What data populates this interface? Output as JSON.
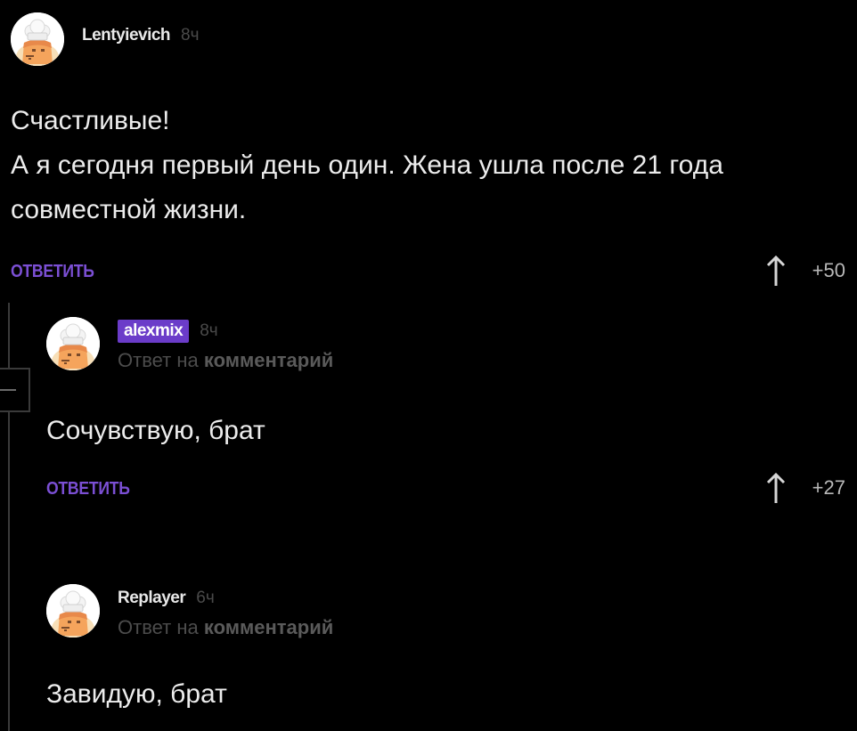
{
  "comments": [
    {
      "username": "Lentyievich",
      "time": "8ч",
      "lines": [
        "Счастливые!",
        "А я сегодня первый день один. Жена ушла после 21 года",
        "совместной жизни."
      ],
      "reply_label": "ОТВЕТИТЬ",
      "score": "+50"
    },
    {
      "username": "alexmix",
      "time": "8ч",
      "reply_to_prefix": "Ответ на",
      "reply_to_link": "комментарий",
      "lines": [
        "Сочувствую, брат"
      ],
      "reply_label": "ОТВЕТИТЬ",
      "score": "+27"
    },
    {
      "username": "Replayer",
      "time": "6ч",
      "reply_to_prefix": "Ответ на",
      "reply_to_link": "комментарий",
      "lines": [
        "Завидую, брат"
      ]
    }
  ],
  "colors": {
    "background": "#000000",
    "accent": "#7b4fd4",
    "badge": "#6b3cc9"
  },
  "icons": {
    "avatar": "default-avatar-chef-icon",
    "vote": "upvote-arrow-icon",
    "collapse": "collapse-thread-icon"
  }
}
